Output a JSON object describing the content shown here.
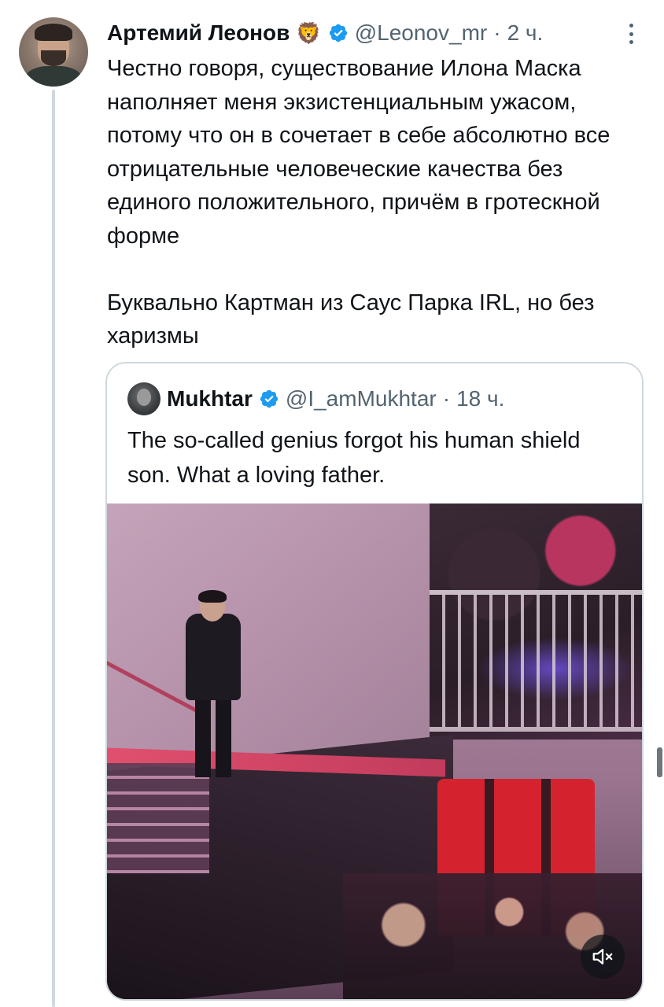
{
  "tweet": {
    "author_name": "Артемий Леонов",
    "author_emoji": "🦁",
    "handle": "@Leonov_mr",
    "separator": "·",
    "time": "2 ч.",
    "text": "Честно говоря, существование Илона Маска наполняет меня экзистенциальным ужасом, потому что он в сочетает в себе абсолютно все отрицательные человеческие качества без единого положительного, причём в гротескной форме\n\nБуквально Картман из Саус Парка IRL, но без харизмы"
  },
  "quote": {
    "author_name": "Mukhtar",
    "handle": "@I_amMukhtar",
    "separator": "·",
    "time": "18 ч.",
    "text": "The so-called genius forgot his human shield son. What a loving father."
  },
  "media": {
    "type": "video",
    "mute_icon": "volume-mute-icon"
  },
  "colors": {
    "verified_blue": "#1d9bf0",
    "secondary_text": "#536471",
    "border": "#cfd9de"
  }
}
